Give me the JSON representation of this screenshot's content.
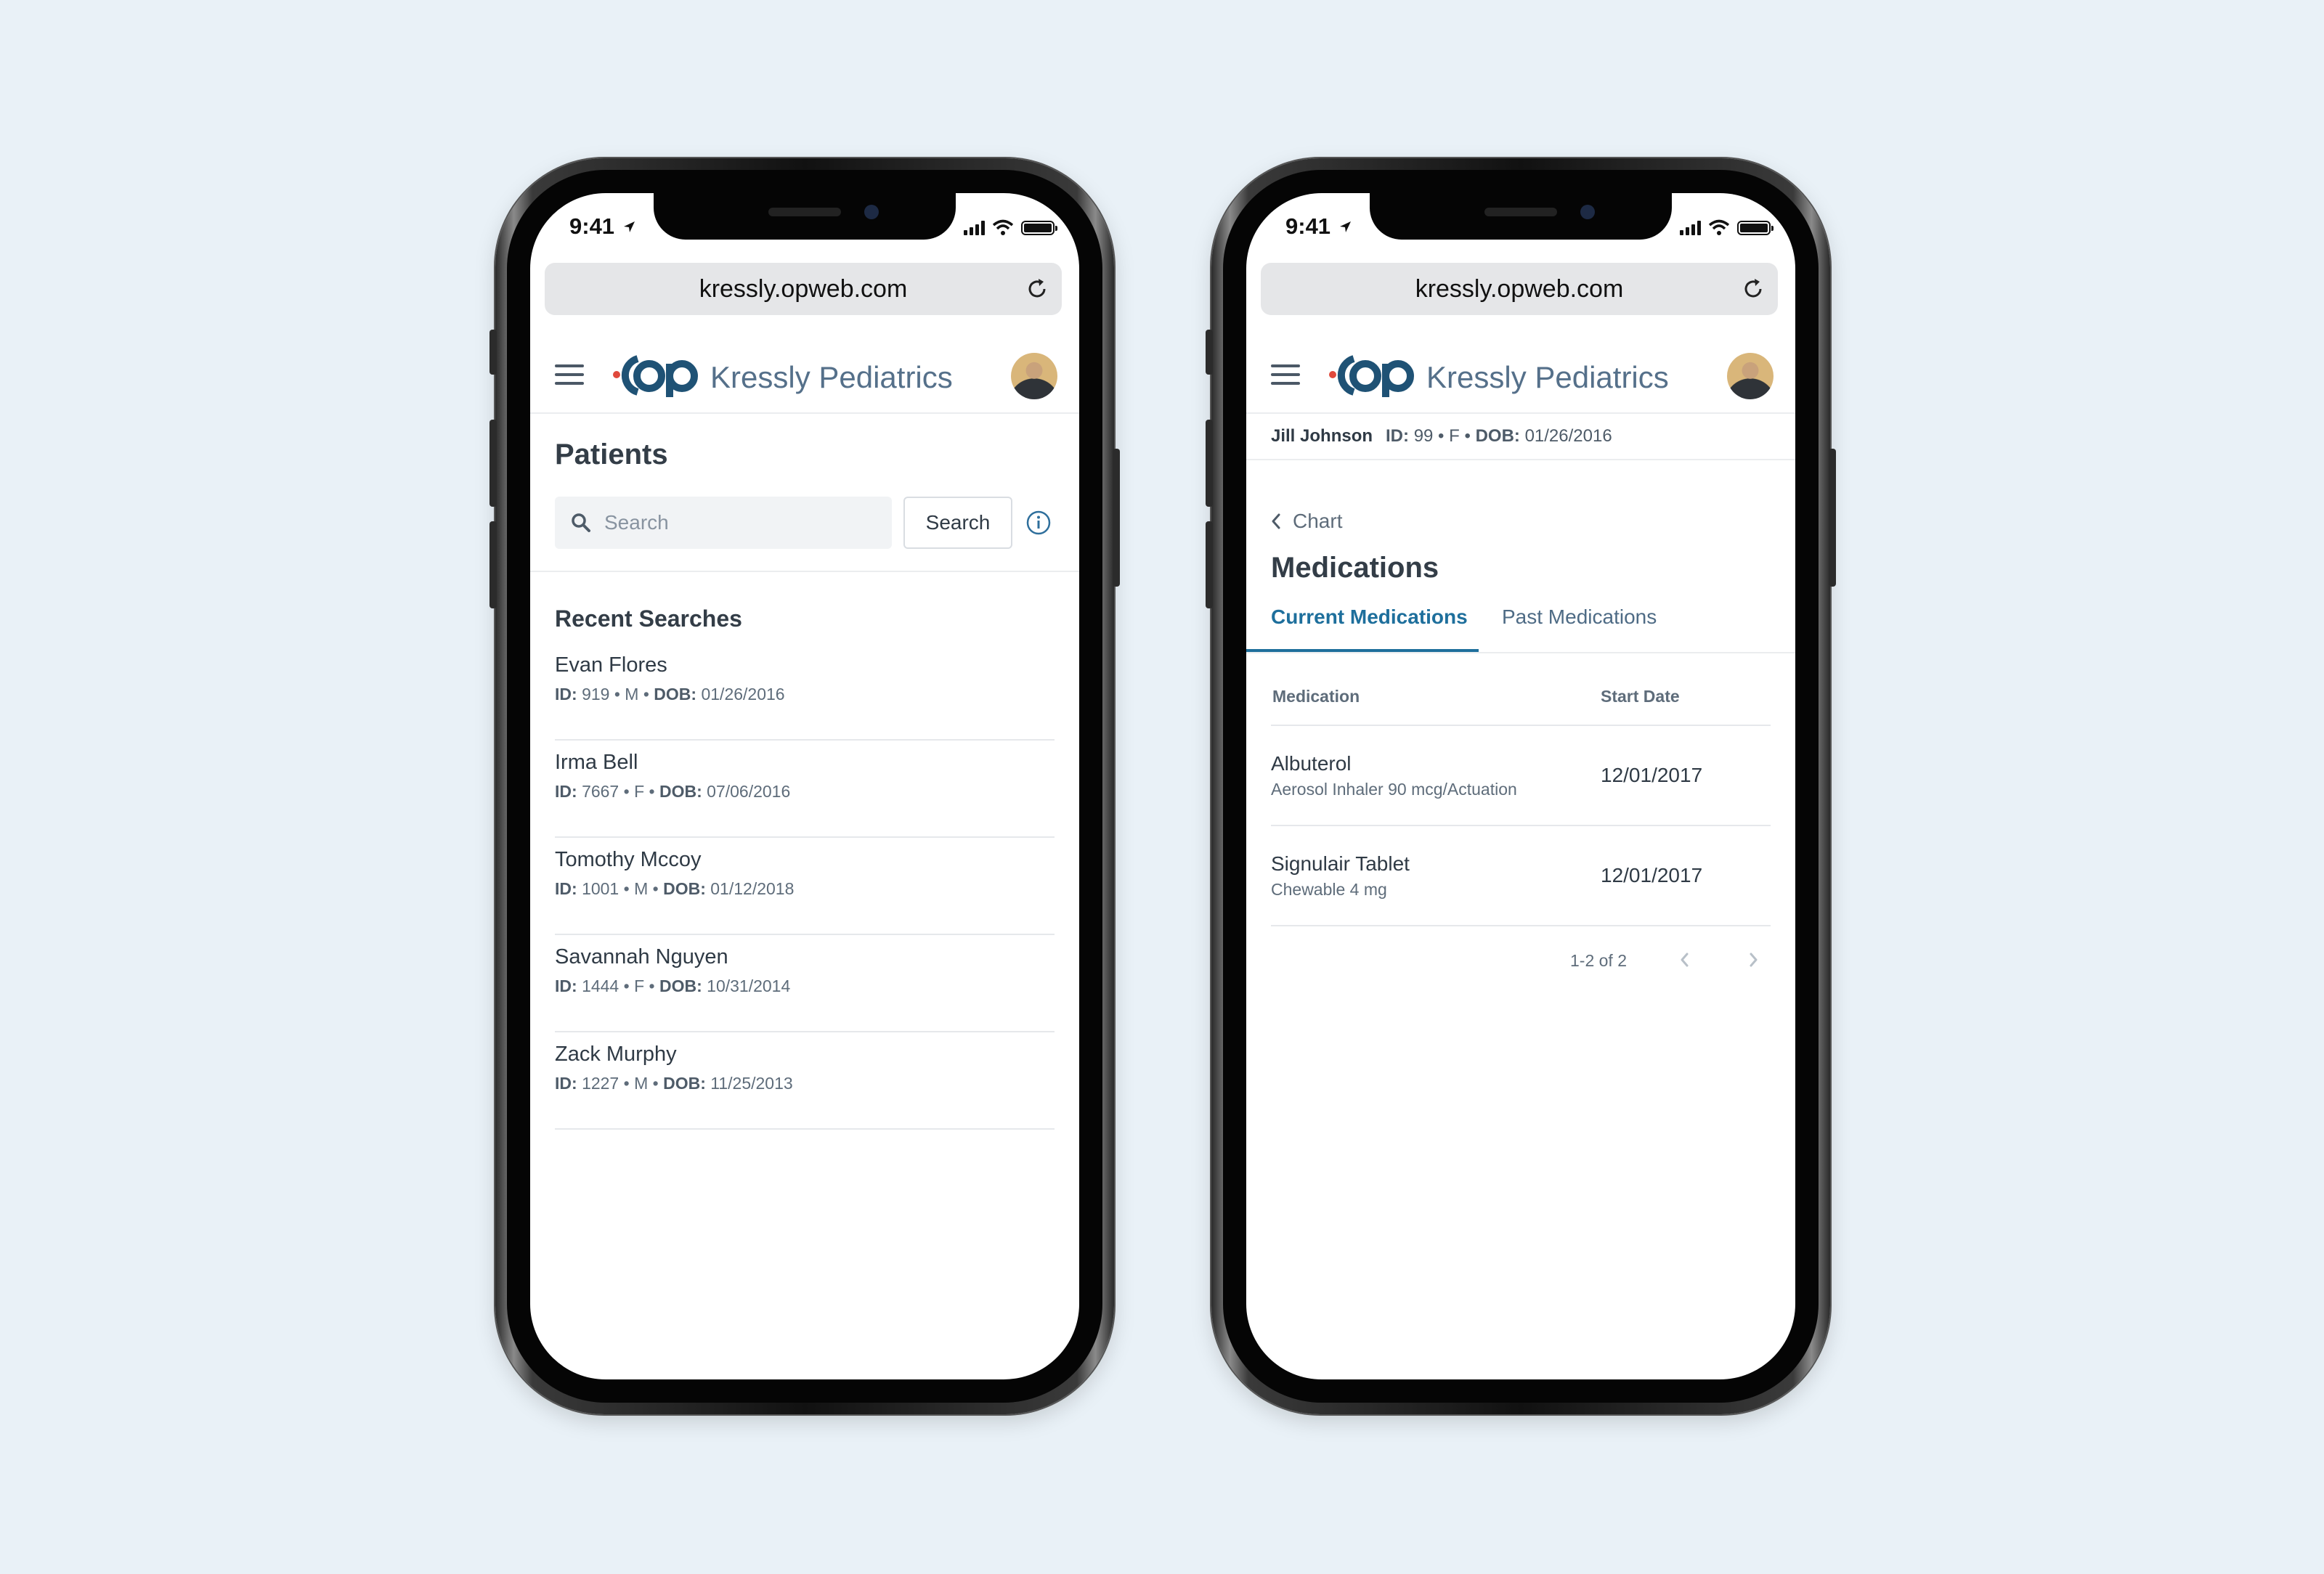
{
  "status": {
    "time": "9:41"
  },
  "browser": {
    "url": "kressly.opweb.com"
  },
  "app": {
    "brand": "Kressly Pediatrics"
  },
  "patients_screen": {
    "title": "Patients",
    "search_placeholder": "Search",
    "search_button": "Search",
    "recent_title": "Recent Searches",
    "recent": [
      {
        "name": "Evan Flores",
        "id_label": "ID:",
        "id": "919",
        "sex": "M",
        "dob_label": "DOB:",
        "dob": "01/26/2016"
      },
      {
        "name": "Irma Bell",
        "id_label": "ID:",
        "id": "7667",
        "sex": "F",
        "dob_label": "DOB:",
        "dob": "07/06/2016"
      },
      {
        "name": "Tomothy Mccoy",
        "id_label": "ID:",
        "id": "1001",
        "sex": "M",
        "dob_label": "DOB:",
        "dob": "01/12/2018"
      },
      {
        "name": "Savannah Nguyen",
        "id_label": "ID:",
        "id": "1444",
        "sex": "F",
        "dob_label": "DOB:",
        "dob": "10/31/2014"
      },
      {
        "name": "Zack Murphy",
        "id_label": "ID:",
        "id": "1227",
        "sex": "M",
        "dob_label": "DOB:",
        "dob": "11/25/2013"
      }
    ]
  },
  "medications_screen": {
    "patient": {
      "name": "Jill Johnson",
      "id_label": "ID:",
      "id": "99",
      "sex": "F",
      "dob_label": "DOB:",
      "dob": "01/26/2016"
    },
    "back_label": "Chart",
    "title": "Medications",
    "tabs": [
      "Current Medications",
      "Past Medications"
    ],
    "columns": [
      "Medication",
      "Start Date"
    ],
    "rows": [
      {
        "name": "Albuterol",
        "detail": "Aerosol Inhaler 90 mcg/Actuation",
        "start_date": "12/01/2017"
      },
      {
        "name": "Signulair Tablet",
        "detail": "Chewable 4 mg",
        "start_date": "12/01/2017"
      }
    ],
    "pagination": "1-2 of 2"
  },
  "icons": [
    "location-arrow-icon",
    "signal-icon",
    "wifi-icon",
    "battery-icon",
    "reload-icon",
    "menu-icon",
    "logo-icon",
    "avatar",
    "search-icon",
    "info-icon",
    "chevron-left-icon",
    "chevron-right-icon"
  ],
  "colors": {
    "accent": "#1e6f9c",
    "brand_text": "#55708a",
    "logo": "#1f5275",
    "logo_dot": "#e0493c",
    "background": "#e9f1f7"
  }
}
